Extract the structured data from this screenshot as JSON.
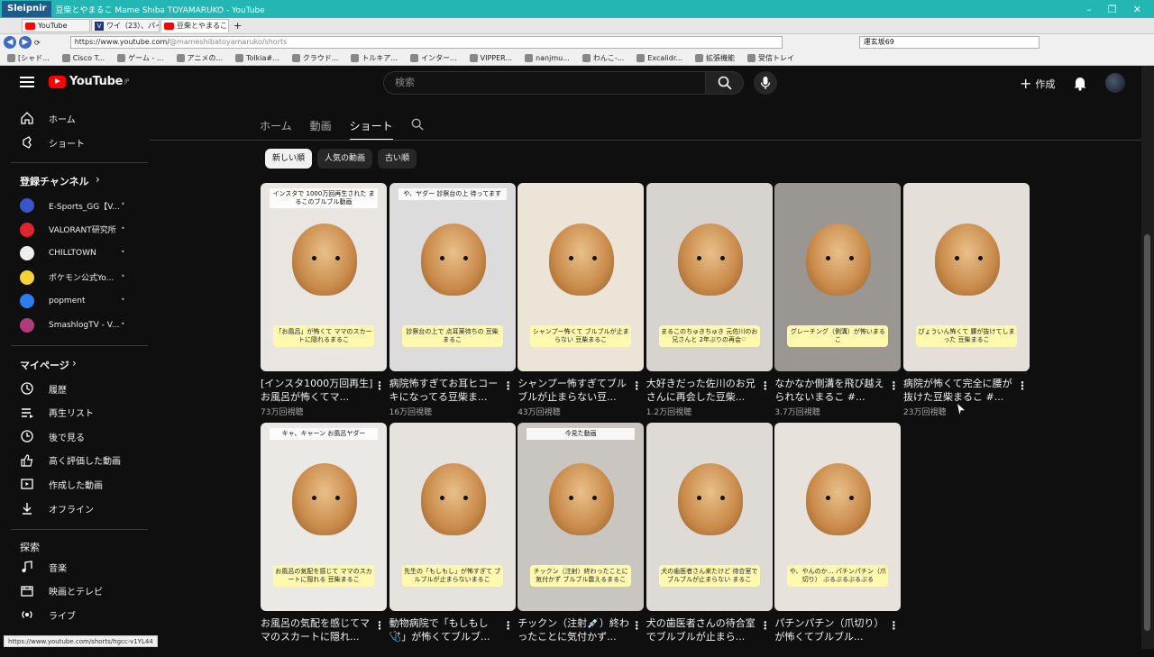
{
  "browser": {
    "app_name": "Sleipnir",
    "window_title": "豆柴とやまるこ Mame Shiba TOYAMARUKO - YouTube",
    "tabs": [
      {
        "label": "YouTube",
        "type": "yt"
      },
      {
        "label": "ワイ（23）、パイ...",
        "type": "v"
      },
      {
        "label": "豆柴とやまるこ M...",
        "type": "yt"
      }
    ],
    "new_tab": "+",
    "url_host": "https://www.youtube.com/",
    "url_path": "@mameshibatoyamaruko/shorts",
    "search_value": "運玄坂69",
    "bookmarks": [
      "[シャド...",
      "Cisco T...",
      "ゲーム - ...",
      "アニメの...",
      "Tolkia#...",
      "クラウド...",
      "トルキア...",
      "インター...",
      "VIPPER...",
      "nanjmu...",
      "わんこ-...",
      "Excalidr...",
      "拡張機能",
      "受信トレイ"
    ],
    "status_url": "https://www.youtube.com/shorts/hgcc-v1YL44"
  },
  "header": {
    "logo_text": "YouTube",
    "logo_region": "JP",
    "search_placeholder": "検索",
    "create_label": "作成"
  },
  "sidebar": {
    "main": [
      {
        "label": "ホーム",
        "icon": "home-icon"
      },
      {
        "label": "ショート",
        "icon": "shorts-icon"
      }
    ],
    "subs_heading": "登録チャンネル",
    "channels": [
      {
        "name": "E-Sports_GG【V...",
        "color": "#3a55c8"
      },
      {
        "name": "VALORANT研究所",
        "color": "#e0242f"
      },
      {
        "name": "CHILLTOWN",
        "color": "#eeeeee"
      },
      {
        "name": "ポケモン公式Yo...",
        "color": "#f3d23a"
      },
      {
        "name": "popment",
        "color": "#2d7df0"
      },
      {
        "name": "SmashlogTV - V...",
        "color": "#b03a7a"
      }
    ],
    "you_heading": "マイページ",
    "you": [
      {
        "label": "履歴",
        "icon": "history-icon"
      },
      {
        "label": "再生リスト",
        "icon": "playlist-icon"
      },
      {
        "label": "後で見る",
        "icon": "watch-later-icon"
      },
      {
        "label": "高く評価した動画",
        "icon": "like-icon"
      },
      {
        "label": "作成した動画",
        "icon": "your-videos-icon"
      },
      {
        "label": "オフライン",
        "icon": "download-icon"
      }
    ],
    "explore_heading": "探索",
    "explore": [
      {
        "label": "音楽",
        "icon": "music-icon"
      },
      {
        "label": "映画とテレビ",
        "icon": "movies-icon"
      },
      {
        "label": "ライブ",
        "icon": "live-icon"
      }
    ]
  },
  "channel_tabs": [
    "ホーム",
    "動画",
    "ショート"
  ],
  "active_tab": "ショート",
  "chips": [
    "新しい順",
    "人気の動画",
    "古い順"
  ],
  "videos": [
    {
      "title": "[インスタ1000万回再生]お風呂が怖くてマ...",
      "views": "73万回視聴",
      "top": "インスタで 1000万回再生された まるこのブルブル動画",
      "cap": "「お風呂」が怖くて ママのスカートに隠れるまるこ",
      "bg": "#e9e6e1"
    },
    {
      "title": "病院怖すぎてお耳ヒコーキになってる豆柴ま...",
      "views": "16万回視聴",
      "top": "や、ヤダー 診察台の上 待ってます",
      "cap": "診察台の上で 点耳薬待ちの 豆柴まるこ",
      "bg": "#dcdcdc"
    },
    {
      "title": "シャンプー怖すぎてブルブルが止まらない豆...",
      "views": "43万回視聴",
      "top": "",
      "cap": "シャンプー怖くて ブルブルが止まらない 豆柴まるこ",
      "bg": "#ece4d6"
    },
    {
      "title": "大好きだった佐川のお兄さんに再会した豆柴...",
      "views": "1.2万回視聴",
      "top": "",
      "cap": "まるこのちゅきちゅき 元佐川のお兄さんと 2年ぶりの再会♡",
      "bg": "#d7d4cf"
    },
    {
      "title": "なかなか側溝を飛び越えられないまるこ #...",
      "views": "3.7万回視聴",
      "top": "",
      "cap": "グレーチング（側溝）が怖いまるこ",
      "bg": "#9a9792"
    },
    {
      "title": "病院が怖くて完全に腰が抜けた豆柴まるこ #...",
      "views": "23万回視聴",
      "top": "",
      "cap": "ぴょういん怖くて 腰が抜けてしまった 豆柴まるこ",
      "bg": "#e4dfd8"
    },
    {
      "title": "お風呂の気配を感じてママのスカートに隠れ...",
      "views": "",
      "top": "キャ、キャーン お風呂ヤダー",
      "cap": "お風呂の気配を感じて ママのスカートに隠れる 豆柴まるこ",
      "bg": "#ebe9e6"
    },
    {
      "title": "動物病院で「もしもし🩺」が怖くてブルブ...",
      "views": "",
      "top": "",
      "cap": "先生の「もしもし」が怖すぎて ブルブルが止まらないまるこ",
      "bg": "#e6e3df"
    },
    {
      "title": "チックン（注射💉）終わったことに気付かず...",
      "views": "",
      "top": "今見た動画",
      "cap": "チックン（注射）終わったことに気付かず ブルブル震えるまるこ",
      "bg": "#c9c6c2"
    },
    {
      "title": "犬の歯医者さんの待合室でブルブルが止まら...",
      "views": "",
      "top": "",
      "cap": "犬の歯医者さん来たけど 待合室で ブルブルが止まらない まるこ",
      "bg": "#dedbd6"
    },
    {
      "title": "パチンパチン（爪切り）が怖くてブルブル...",
      "views": "",
      "top": "",
      "cap": "や、やんのか… パチンパチン（爪切り） ぶるぶるぶるぶる",
      "bg": "#e7e2db"
    }
  ]
}
